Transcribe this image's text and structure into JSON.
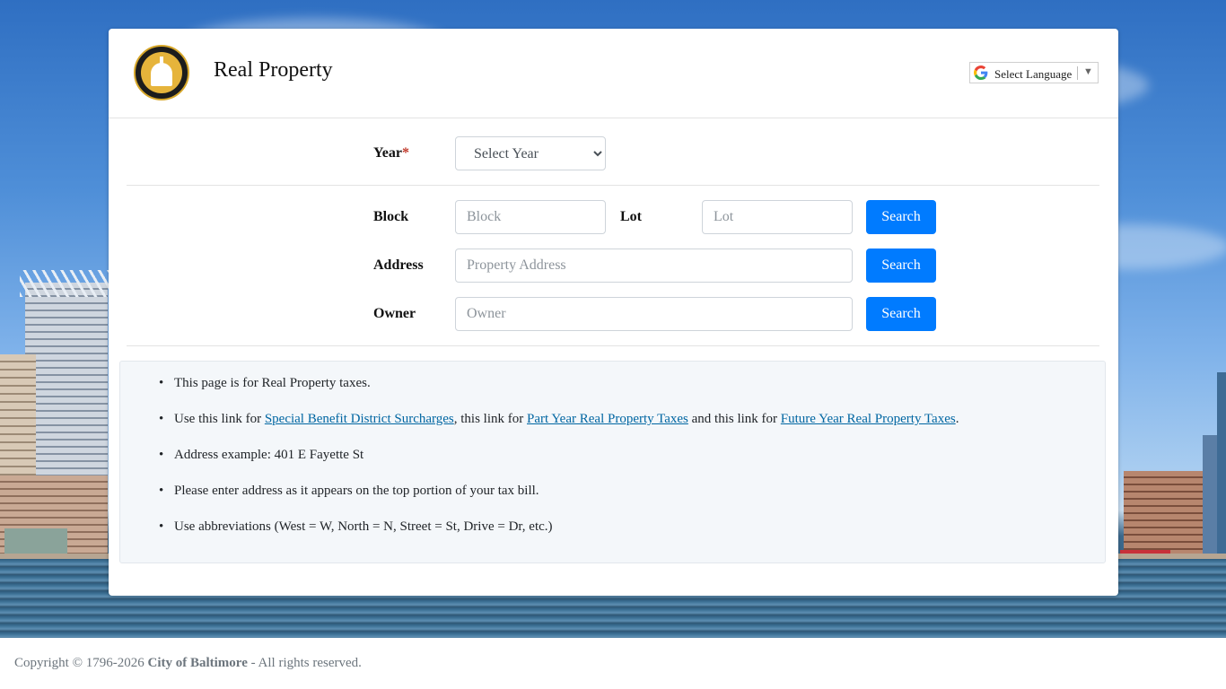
{
  "header": {
    "title": "Real Property",
    "language_label": "Select Language"
  },
  "form": {
    "year": {
      "label": "Year",
      "required_mark": "*",
      "selected": "Select Year"
    },
    "block": {
      "label": "Block",
      "placeholder": "Block"
    },
    "lot": {
      "label": "Lot",
      "placeholder": "Lot"
    },
    "address": {
      "label": "Address",
      "placeholder": "Property Address"
    },
    "owner": {
      "label": "Owner",
      "placeholder": "Owner"
    },
    "search_label": "Search"
  },
  "info": {
    "item1": "This page is for Real Property taxes.",
    "item2": {
      "t1": "Use this link for ",
      "link1": "Special Benefit District Surcharges",
      "t2": ", this link for ",
      "link2": "Part Year Real Property Taxes",
      "t3": " and this link for ",
      "link3": "Future Year Real Property Taxes",
      "t4": "."
    },
    "item3": "Address example: 401 E Fayette St",
    "item4": "Please enter address as it appears on the top portion of your tax bill.",
    "item5": "Use abbreviations (West = W, North = N, Street = St, Drive = Dr, etc.)"
  },
  "footer": {
    "prefix": "Copyright © 1796-2026 ",
    "org": "City of Baltimore",
    "suffix": " - All rights reserved."
  },
  "colors": {
    "primary_button": "#007bff",
    "link": "#0066a2",
    "required": "#c0392b"
  },
  "icons": {
    "logo": "city-seal-logo",
    "language": "google-g-icon",
    "dropdown": "caret-down-icon"
  }
}
